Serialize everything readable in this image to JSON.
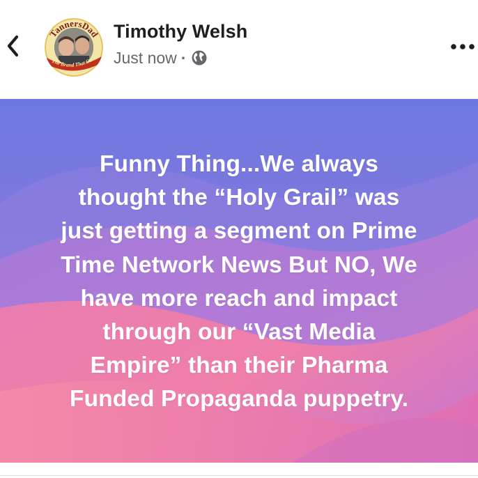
{
  "post": {
    "author": {
      "name": "Timothy Welsh",
      "avatar_label_top": "TannersDad",
      "avatar_label_bottom": "The Brand That Cares"
    },
    "timestamp": "Just now",
    "separator": "·",
    "privacy_icon": "globe-icon",
    "back_icon": "chevron-left-icon",
    "more_icon": "more-horizontal-icon",
    "body": "Funny Thing...We always\nthought the “Holy Grail” was\njust getting a segment on Prime\nTime Network News But NO, We\nhave more reach and impact\nthrough our “Vast Media\nEmpire” than their Pharma\nFunded Propaganda puppetry.",
    "background_colors": {
      "top": "#6f7ee3",
      "middle": "#b872cf",
      "bottom": "#f07ea8"
    }
  }
}
